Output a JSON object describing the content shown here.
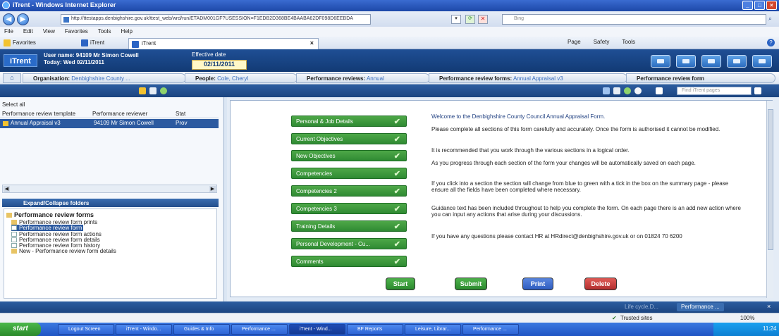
{
  "window": {
    "title": "iTrent - Windows Internet Explorer"
  },
  "browser": {
    "url": "http://ttestapps.denbighshire.gov.uk/ttest_web/wrd/run/ETADM001GF?USESSION=F1EDB2D368BE4BAABA62DF098D6EEBDA",
    "search_placeholder": "Bing",
    "menu": [
      "File",
      "Edit",
      "View",
      "Favorites",
      "Tools",
      "Help"
    ],
    "favorites_label": "Favorites",
    "fav_tab_label": "iTrent",
    "tab_title": "iTrent",
    "toolbar_right": [
      "Page",
      "Safety",
      "Tools"
    ]
  },
  "header": {
    "logo": "iTrent",
    "user_line": "User name: 94109 Mr Simon Cowell",
    "today_line": "Today: Wed 02/11/2011",
    "effective_label": "Effective date",
    "effective_value": "02/11/2011"
  },
  "breadcrumb": [
    {
      "label": "Organisation:",
      "value": "Denbighshire County ..."
    },
    {
      "label": "People:",
      "value": "Cole, Cheryl"
    },
    {
      "label": "Performance reviews:",
      "value": "Annual"
    },
    {
      "label": "Performance review forms:",
      "value": "Annual Appraisal v3"
    },
    {
      "label": "Performance review form",
      "value": ""
    }
  ],
  "find_placeholder": "Find iTrent pages",
  "left": {
    "select_all": "Select all",
    "columns": [
      "Performance review template",
      "Performance reviewer",
      "Stat"
    ],
    "row": [
      "Annual Appraisal v3",
      "94109 Mr Simon Cowell",
      "Prov"
    ],
    "expand_label": "Expand/Collapse folders",
    "tree_root": "Performance review forms",
    "tree_items": [
      "Performance review form prints",
      "Performance review form",
      "Performance review form actions",
      "Performance review form details",
      "Performance review form history",
      "New - Performance review form details"
    ]
  },
  "sections": [
    "Personal & Job Details",
    "Current Objectives",
    "New Objectives",
    "Competencies",
    "Competencies 2",
    "Competencies 3",
    "Training Details",
    "Personal Development - Cu...",
    "Comments"
  ],
  "messages": [
    "Welcome to the Denbighshire County Council Annual Appraisal Form.",
    "Please complete all sections of this form carefully and accurately.  Once the form is authorised it cannot be modified.",
    "It is recommended that you work through the various sections in a logical order.",
    "As you progress through each section of the form your changes will be automatically saved on each page.",
    "If you click into a section the section will change from blue to green with a tick in the box on the summary page - please ensure all the fields have been completed where necessary.",
    "Guidance text has been included throughout to help you complete the form. On each page there is an add new action where you can input any actions that arise during your discussions.",
    "If you have any questions please contact HR at HRdirect@denbighshire.gov.uk or on 01824 70 6200"
  ],
  "buttons": {
    "start": "Start",
    "submit": "Submit",
    "print": "Print",
    "delete": "Delete"
  },
  "bottom_tabs": [
    "Life cycle,D...",
    "Performance ..."
  ],
  "status": {
    "zone": "Trusted sites",
    "zoom": "100%"
  },
  "taskbar": {
    "start": "start",
    "items": [
      "Logout Screen",
      "iTrent - Windo...",
      "Guides & Info",
      "Performance ...",
      "iTrent - Wind...",
      "BF Reports",
      "Leisure, Librar...",
      "Performance ..."
    ],
    "clock": "11:24"
  },
  "colors": {
    "accent": "#1f4f95",
    "section_green": "#3a9a3c",
    "start": "#2f8a33",
    "submit": "#2f8a33",
    "print": "#3563c4",
    "delete": "#c23a3a"
  }
}
